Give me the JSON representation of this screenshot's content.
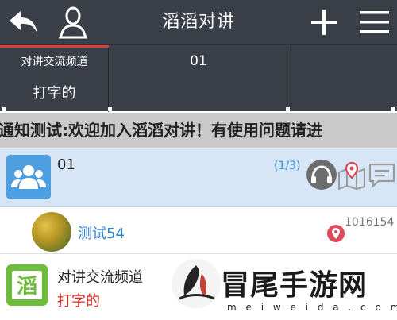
{
  "header": {
    "title": "滔滔对讲",
    "icons": {
      "back": "back-arrow-icon",
      "user": "user-icon",
      "add": "plus-icon",
      "menu": "hamburger-menu-icon"
    }
  },
  "tabs": [
    {
      "name": "对讲交流频道",
      "subtitle": "打字的",
      "active": true
    },
    {
      "name": "01"
    },
    {
      "name": ""
    }
  ],
  "notice": {
    "text": "通知测试:欢迎加入滔滔对讲！有使用问题请进"
  },
  "group": {
    "name": "01",
    "count": "(1/3)",
    "icons": [
      "headset-icon",
      "map-pin-icon",
      "chat-icon"
    ]
  },
  "member": {
    "name": "测试54",
    "id": "1016154"
  },
  "channel": {
    "name": "对讲交流频道",
    "subtitle": "打字的",
    "icon_glyph": "滔"
  },
  "watermark": {
    "title": "冒尾手游网",
    "subtitle": "m e i w e i d a . c o m"
  },
  "colors": {
    "topbar": "#3b4048",
    "accent_red": "#d9403a",
    "group_bg": "#d7e6f7",
    "link_blue": "#2f7fd0",
    "channel_green": "#6bbd3a"
  }
}
